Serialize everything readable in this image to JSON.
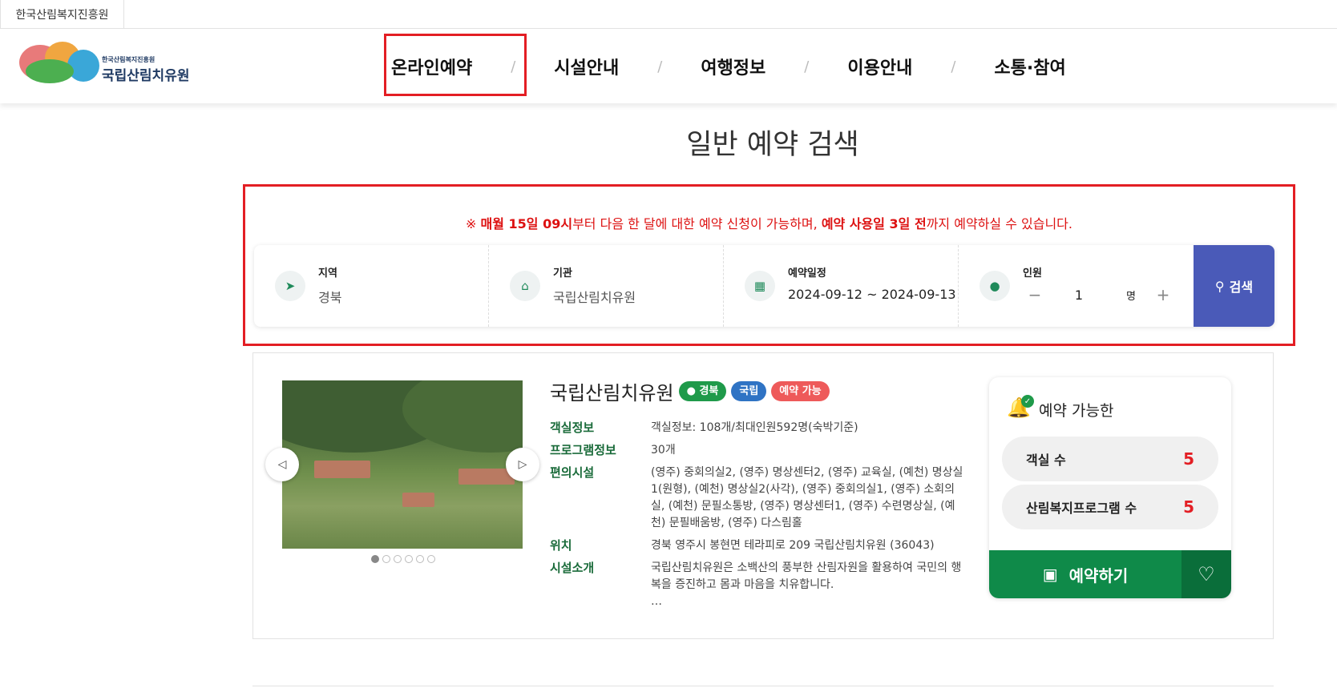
{
  "topbar": {
    "org_name": "한국산림복지진흥원"
  },
  "logo": {
    "sub": "한국산림복지진흥원",
    "main": "국립산림치유원"
  },
  "nav": {
    "items": [
      {
        "label": "온라인예약"
      },
      {
        "label": "시설안내"
      },
      {
        "label": "여행정보"
      },
      {
        "label": "이용안내"
      },
      {
        "label": "소통·참여"
      }
    ],
    "separator": "/"
  },
  "page": {
    "title": "일반 예약 검색"
  },
  "notice": {
    "prefix": "※ ",
    "part1": "매월 15일 09시",
    "part2": "부터 다음 한 달에 대한 예약 신청이 가능하며, ",
    "part3": "예약 사용일 3일 전",
    "part4": "까지 예약하실 수 있습니다."
  },
  "search": {
    "region": {
      "label": "지역",
      "value": "경북",
      "icon": "location-arrow-icon"
    },
    "institution": {
      "label": "기관",
      "value": "국립산림치유원",
      "icon": "home-icon"
    },
    "schedule": {
      "label": "예약일정",
      "value": "2024-09-12 ~ 2024-09-13",
      "icon": "calendar-icon"
    },
    "people": {
      "label": "인원",
      "minus": "−",
      "count": "1",
      "unit": "명",
      "plus": "+",
      "icon": "user-icon"
    },
    "button": "검색"
  },
  "result": {
    "name": "국립산림치유원",
    "badges": {
      "region": "경북",
      "type": "국립",
      "status": "예약 가능"
    },
    "rows": [
      {
        "key": "객실정보",
        "value": "객실정보: 108개/최대인원592명(숙박기준)"
      },
      {
        "key": "프로그램정보",
        "value": "30개"
      },
      {
        "key": "편의시설",
        "value": "(영주) 중회의실2, (영주) 명상센터2, (영주) 교육실, (예천) 명상실1(원형), (예천) 명상실2(사각), (영주) 중회의실1, (영주) 소회의실, (예천) 문필소통방, (영주) 명상센터1, (영주) 수련명상실, (예천) 문필배움방, (영주) 다스림홀"
      },
      {
        "key": "위치",
        "value": "경북 영주시 봉현면 테라피로 209 국립산림치유원 (36043)"
      },
      {
        "key": "시설소개",
        "value": "국립산림치유원은 소백산의 풍부한 산림자원을 활용하여 국민의 행복을 증진하고 몸과 마음을 치유합니다.",
        "more": "…"
      }
    ],
    "slider": {
      "total_dots": 6,
      "active_dot": 1
    }
  },
  "availability": {
    "title": "예약 가능한",
    "rooms_label": "객실 수",
    "rooms_count": "5",
    "programs_label": "산림복지프로그램 수",
    "programs_count": "5",
    "reserve_button": "예약하기"
  },
  "colors": {
    "accent_red": "#e31e24",
    "search_button": "#4a5ab8",
    "reserve_green": "#0f8a49",
    "label_green": "#1a6b3a"
  }
}
